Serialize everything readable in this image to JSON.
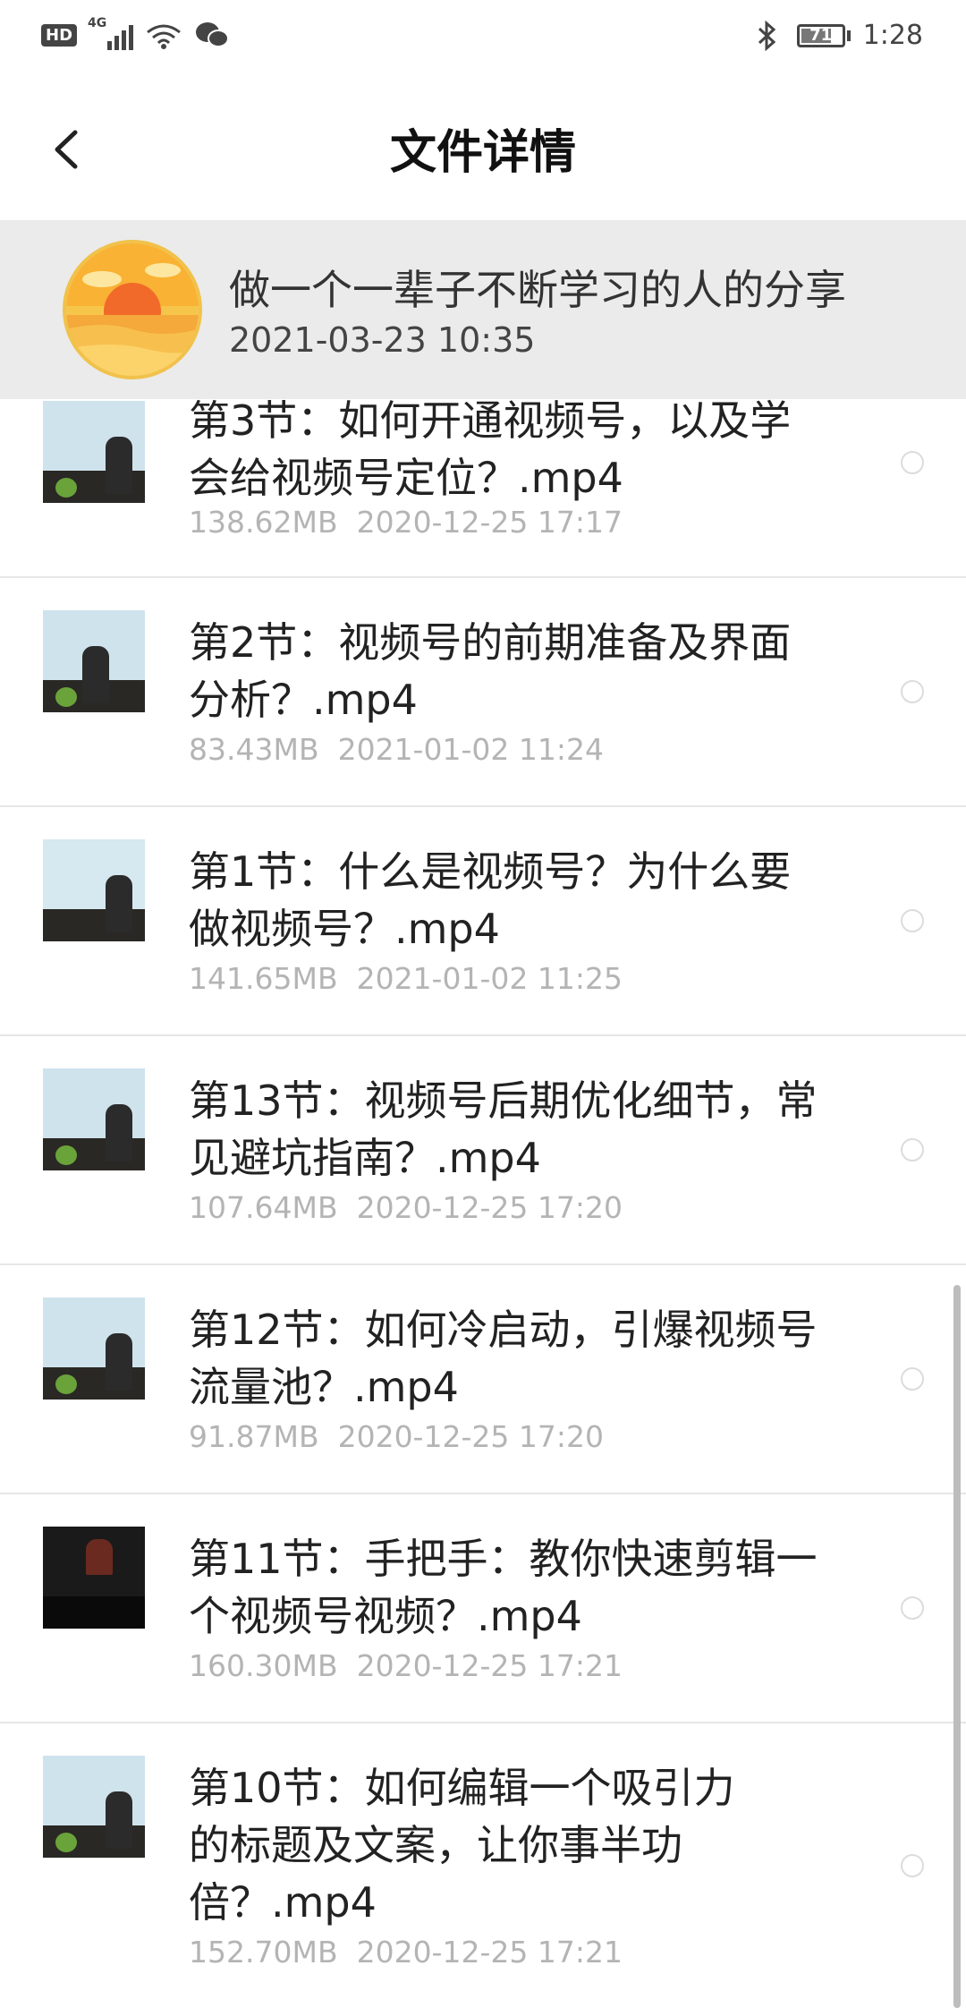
{
  "status_bar": {
    "hd": "HD",
    "network": "4G",
    "battery": "71",
    "time": "1:28"
  },
  "header": {
    "title": "文件详情"
  },
  "owner": {
    "name": "做一个一辈子不断学习的人的分享",
    "date": "2021-03-23  10:35"
  },
  "files": [
    {
      "name": "第3节：如何开通视频号，以及学会给视频号定位？.mp4",
      "size": "138.62MB",
      "date": "2020-12-25  17:17"
    },
    {
      "name": "第2节：视频号的前期准备及界面分析？.mp4",
      "size": "83.43MB",
      "date": "2021-01-02  11:24"
    },
    {
      "name": "第1节：什么是视频号？为什么要做视频号？.mp4",
      "size": "141.65MB",
      "date": "2021-01-02  11:25"
    },
    {
      "name": "第13节：视频号后期优化细节，常见避坑指南？.mp4",
      "size": "107.64MB",
      "date": "2020-12-25  17:20"
    },
    {
      "name": "第12节：如何冷启动，引爆视频号流量池？.mp4",
      "size": "91.87MB",
      "date": "2020-12-25  17:20"
    },
    {
      "name": "第11节：手把手：教你快速剪辑一个视频号视频？.mp4",
      "size": "160.30MB",
      "date": "2020-12-25  17:21"
    },
    {
      "name": "第10节：如何编辑一个吸引力的标题及文案，让你事半功倍？.mp4",
      "size": "152.70MB",
      "date": "2020-12-25  17:21"
    }
  ]
}
